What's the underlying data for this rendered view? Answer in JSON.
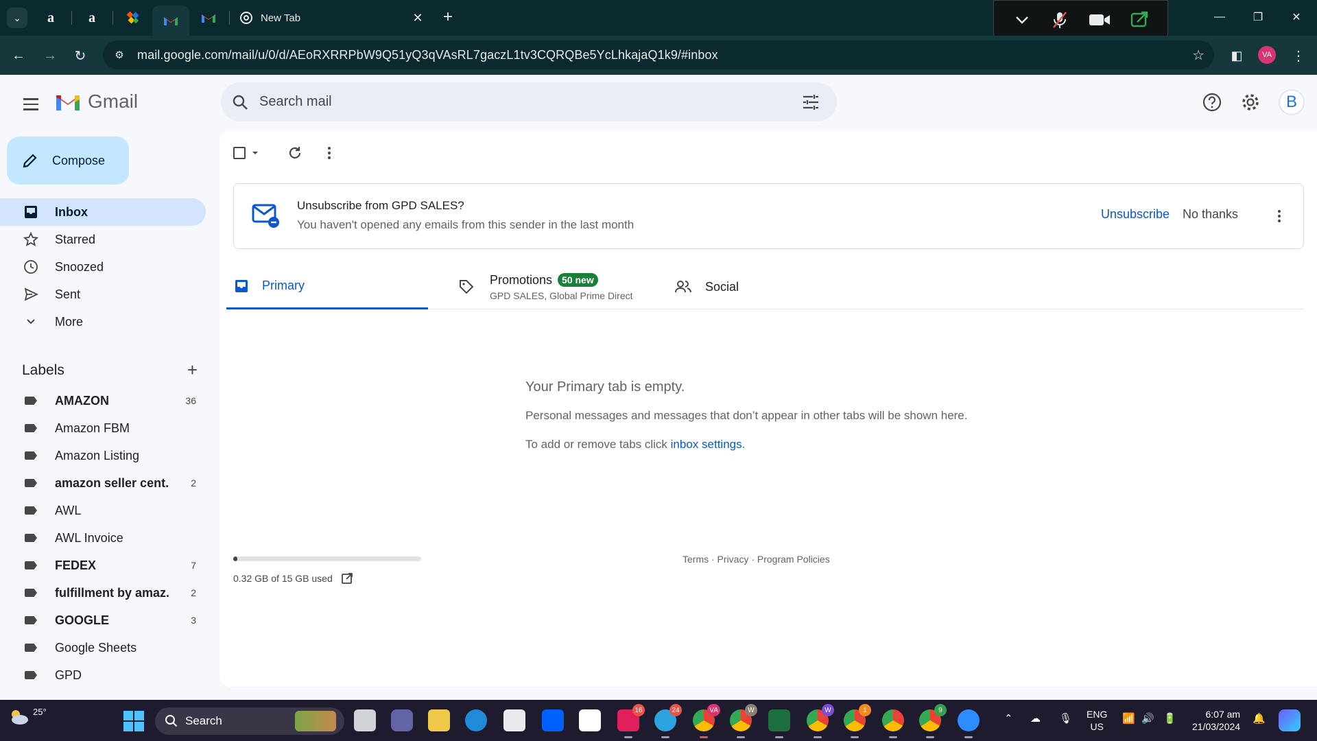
{
  "browser": {
    "active_tab_title": "New Tab",
    "url": "mail.google.com/mail/u/0/d/AEoRXRRPbW9Q51yQ3qVAsRL7gaczL1tv3CQRQBe5YcLhkajaQ1k9/#inbox",
    "profile_initials": "VA"
  },
  "gmail": {
    "wordmark": "Gmail",
    "search_placeholder": "Search mail",
    "account_initial": "B",
    "compose_label": "Compose",
    "nav": [
      {
        "label": "Inbox"
      },
      {
        "label": "Starred"
      },
      {
        "label": "Snoozed"
      },
      {
        "label": "Sent"
      },
      {
        "label": "More"
      }
    ],
    "labels_header": "Labels",
    "labels": [
      {
        "name": "AMAZON",
        "count": "36",
        "bold": true
      },
      {
        "name": "Amazon FBM",
        "count": "",
        "bold": false
      },
      {
        "name": "Amazon Listing",
        "count": "",
        "bold": false
      },
      {
        "name": "amazon seller cent...",
        "count": "2",
        "bold": true
      },
      {
        "name": "AWL",
        "count": "",
        "bold": false
      },
      {
        "name": "AWL Invoice",
        "count": "",
        "bold": false
      },
      {
        "name": "FEDEX",
        "count": "7",
        "bold": true
      },
      {
        "name": "fulfillment by amaz...",
        "count": "2",
        "bold": true
      },
      {
        "name": "GOOGLE",
        "count": "3",
        "bold": true
      },
      {
        "name": "Google Sheets",
        "count": "",
        "bold": false
      },
      {
        "name": "GPD",
        "count": "",
        "bold": false
      }
    ],
    "banner": {
      "title": "Unsubscribe from GPD SALES?",
      "subtitle": "You haven't opened any emails from this sender in the last month",
      "unsubscribe": "Unsubscribe",
      "no_thanks": "No thanks"
    },
    "tabs": {
      "primary": "Primary",
      "promotions": "Promotions",
      "promotions_badge": "50 new",
      "promotions_senders": "GPD SALES, Global Prime Direct",
      "social": "Social"
    },
    "empty": {
      "title": "Your Primary tab is empty.",
      "body": "Personal messages and messages that don’t appear in other tabs will be shown here.",
      "settings_prefix": "To add or remove tabs click ",
      "settings_link": "inbox settings",
      "settings_suffix": "."
    },
    "storage": {
      "text": "0.32 GB of 15 GB used",
      "used_fraction": 0.021
    },
    "footer": "Terms · Privacy · Program Policies"
  },
  "taskbar": {
    "weather": "25°",
    "search": "Search",
    "badges": {
      "slack": "16",
      "telegram": "24",
      "chrome_va": "VA",
      "chrome_w1": "W",
      "chrome_w2": "W",
      "chrome_1": "1",
      "chrome_9": "9"
    },
    "lang_top": "ENG",
    "lang_bottom": "US",
    "time": "6:07 am",
    "date": "21/03/2024",
    "colors": {
      "accent": "#0b57d0",
      "badge_green": "#188038"
    }
  }
}
